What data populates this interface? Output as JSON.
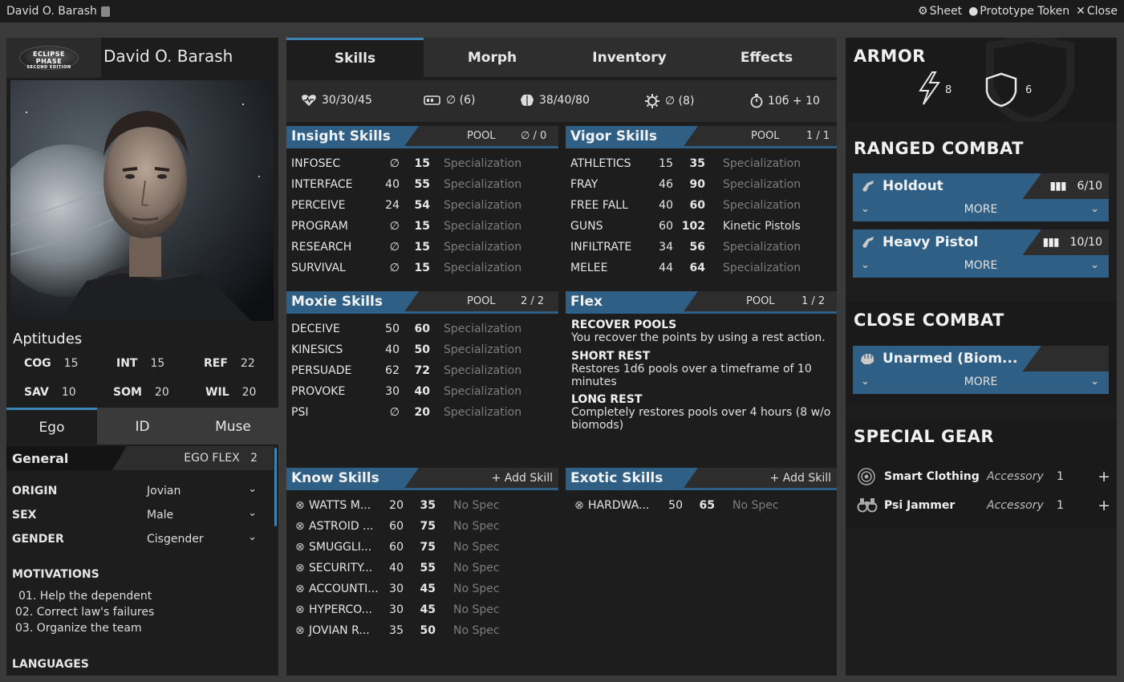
{
  "window": {
    "title": "David O. Barash",
    "actions": {
      "sheet": "Sheet",
      "token": "Prototype Token",
      "close": "Close"
    }
  },
  "header": {
    "logo_line1": "ECLIPSE",
    "logo_line2": "PHASE",
    "logo_line3": "SECOND EDITION",
    "name": "David O. Barash"
  },
  "aptitudes": {
    "title": "Aptitudes",
    "items": [
      {
        "label": "COG",
        "value": "15"
      },
      {
        "label": "INT",
        "value": "15"
      },
      {
        "label": "REF",
        "value": "22"
      },
      {
        "label": "SAV",
        "value": "10"
      },
      {
        "label": "SOM",
        "value": "20"
      },
      {
        "label": "WIL",
        "value": "20"
      }
    ]
  },
  "subtabs": [
    "Ego",
    "ID",
    "Muse"
  ],
  "general": {
    "title": "General",
    "ego_flex_label": "EGO FLEX",
    "ego_flex_value": "2",
    "fields": [
      {
        "label": "ORIGIN",
        "value": "Jovian"
      },
      {
        "label": "SEX",
        "value": "Male"
      },
      {
        "label": "GENDER",
        "value": "Cisgender"
      }
    ],
    "motivations_title": "MOTIVATIONS",
    "motivations": [
      "01. Help the dependent",
      "02. Correct law's failures",
      "03. Organize the team"
    ],
    "languages_title": "LANGUAGES"
  },
  "tabs": [
    "Skills",
    "Morph",
    "Inventory",
    "Effects"
  ],
  "stats": {
    "health": "30/30/45",
    "armor_pool": "∅ (6)",
    "mind": "38/40/80",
    "infection": "∅ (8)",
    "initiative": "10б + 10"
  },
  "insight": {
    "title": "Insight Skills",
    "pool_label": "POOL",
    "pool_value": "∅ / 0",
    "rows": [
      {
        "name": "INFOSEC",
        "a": "∅",
        "b": "15",
        "spec": "Specialization"
      },
      {
        "name": "INTERFACE",
        "a": "40",
        "b": "55",
        "spec": "Specialization"
      },
      {
        "name": "PERCEIVE",
        "a": "24",
        "b": "54",
        "spec": "Specialization"
      },
      {
        "name": "PROGRAM",
        "a": "∅",
        "b": "15",
        "spec": "Specialization"
      },
      {
        "name": "RESEARCH",
        "a": "∅",
        "b": "15",
        "spec": "Specialization"
      },
      {
        "name": "SURVIVAL",
        "a": "∅",
        "b": "15",
        "spec": "Specialization"
      }
    ]
  },
  "vigor": {
    "title": "Vigor Skills",
    "pool_label": "POOL",
    "pool_value": "1 / 1",
    "rows": [
      {
        "name": "ATHLETICS",
        "a": "15",
        "b": "35",
        "spec": "Specialization"
      },
      {
        "name": "FRAY",
        "a": "46",
        "b": "90",
        "spec": "Specialization"
      },
      {
        "name": "FREE FALL",
        "a": "40",
        "b": "60",
        "spec": "Specialization"
      },
      {
        "name": "GUNS",
        "a": "60",
        "b": "102",
        "spec": "Kinetic Pistols"
      },
      {
        "name": "INFILTRATE",
        "a": "34",
        "b": "56",
        "spec": "Specialization"
      },
      {
        "name": "MELEE",
        "a": "44",
        "b": "64",
        "spec": "Specialization"
      }
    ]
  },
  "moxie": {
    "title": "Moxie Skills",
    "pool_label": "POOL",
    "pool_value": "2 / 2",
    "rows": [
      {
        "name": "DECEIVE",
        "a": "50",
        "b": "60",
        "spec": "Specialization"
      },
      {
        "name": "KINESICS",
        "a": "40",
        "b": "50",
        "spec": "Specialization"
      },
      {
        "name": "PERSUADE",
        "a": "62",
        "b": "72",
        "spec": "Specialization"
      },
      {
        "name": "PROVOKE",
        "a": "30",
        "b": "40",
        "spec": "Specialization"
      },
      {
        "name": "PSI",
        "a": "∅",
        "b": "20",
        "spec": "Specialization"
      }
    ]
  },
  "flex": {
    "title": "Flex",
    "pool_label": "POOL",
    "pool_value": "1 / 2",
    "items": [
      {
        "title": "RECOVER POOLS",
        "text": "You recover the points by using a rest action."
      },
      {
        "title": "SHORT REST",
        "text": "Restores 1d6 pools over a timeframe of 10 minutes"
      },
      {
        "title": "LONG REST",
        "text": "Completely restores pools over 4 hours (8 w/o biomods)"
      }
    ]
  },
  "know": {
    "title": "Know Skills",
    "add": "+ Add Skill",
    "rows": [
      {
        "name": "WATTS M...",
        "a": "20",
        "b": "35",
        "spec": "No Spec"
      },
      {
        "name": "ASTROID ...",
        "a": "60",
        "b": "75",
        "spec": "No Spec"
      },
      {
        "name": "SMUGGLI...",
        "a": "60",
        "b": "75",
        "spec": "No Spec"
      },
      {
        "name": "SECURITY...",
        "a": "40",
        "b": "55",
        "spec": "No Spec"
      },
      {
        "name": "ACCOUNTI...",
        "a": "30",
        "b": "45",
        "spec": "No Spec"
      },
      {
        "name": "HYPERCO...",
        "a": "30",
        "b": "45",
        "spec": "No Spec"
      },
      {
        "name": "JOVIAN R...",
        "a": "35",
        "b": "50",
        "spec": "No Spec"
      }
    ]
  },
  "exotic": {
    "title": "Exotic Skills",
    "add": "+ Add Skill",
    "rows": [
      {
        "name": "HARDWA...",
        "a": "50",
        "b": "65",
        "spec": "No Spec"
      }
    ]
  },
  "armor": {
    "title": "ARMOR",
    "energy": "8",
    "kinetic": "6"
  },
  "ranged": {
    "title": "RANGED COMBAT",
    "weapons": [
      {
        "name": "Holdout",
        "ammo": "6/10",
        "more": "MORE"
      },
      {
        "name": "Heavy Pistol",
        "ammo": "10/10",
        "more": "MORE"
      }
    ]
  },
  "close": {
    "title": "CLOSE COMBAT",
    "weapons": [
      {
        "name": "Unarmed (Biom...",
        "more": "MORE"
      }
    ]
  },
  "gear": {
    "title": "SPECIAL GEAR",
    "items": [
      {
        "name": "Smart Clothing",
        "type": "Accessory",
        "qty": "1"
      },
      {
        "name": "Psi Jammer",
        "type": "Accessory",
        "qty": "1"
      }
    ]
  },
  "colors": {
    "accent": "#2f5f85",
    "tab_accent": "#3c83b6",
    "background": "#1d1d1d"
  }
}
